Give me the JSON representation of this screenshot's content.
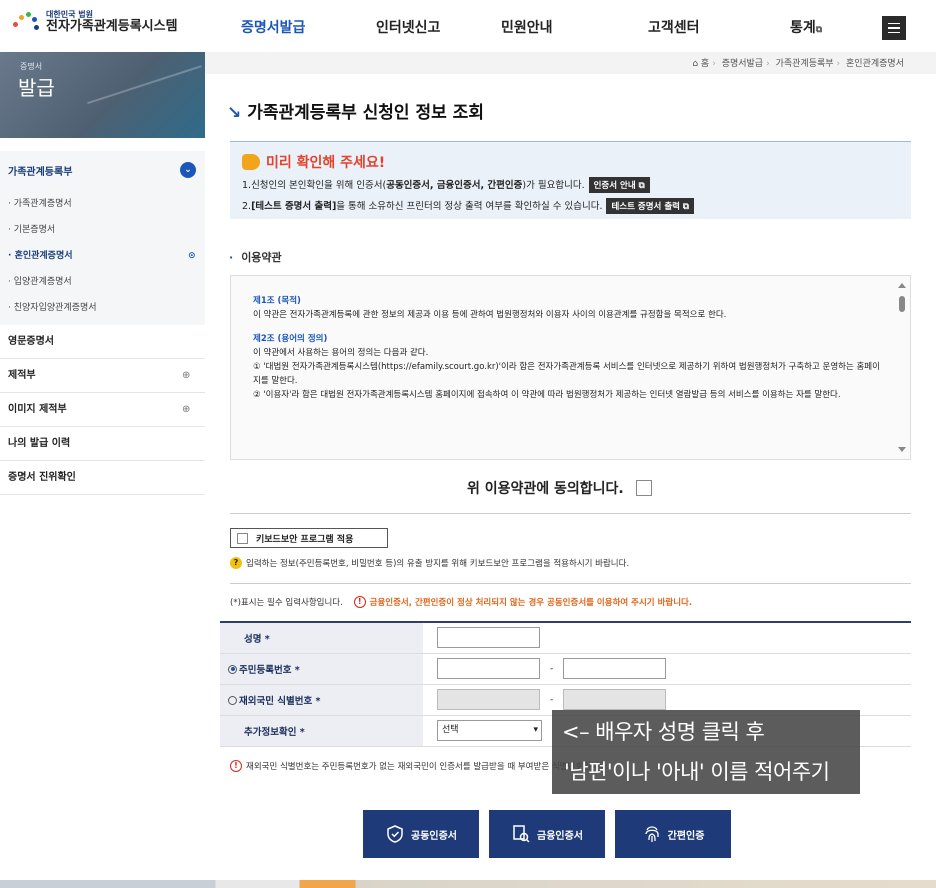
{
  "header": {
    "logo_small": "대한민국 법원",
    "logo_big": "전자가족관계등록시스템",
    "nav": [
      {
        "label": "증명서발급",
        "active": true
      },
      {
        "label": "인터넷신고"
      },
      {
        "label": "민원안내"
      },
      {
        "label": "고객센터"
      },
      {
        "label": "통계"
      }
    ]
  },
  "sidebar": {
    "banner_small": "증명서",
    "banner_big": "발급",
    "group_label": "가족관계등록부",
    "sub_items": [
      {
        "label": "가족관계증명서"
      },
      {
        "label": "기본증명서"
      },
      {
        "label": "혼인관계증명서",
        "active": true
      },
      {
        "label": "입양관계증명서"
      },
      {
        "label": "친양자입양관계증명서"
      }
    ],
    "items": [
      {
        "label": "영문증명서"
      },
      {
        "label": "제적부"
      },
      {
        "label": "이미지 제적부"
      },
      {
        "label": "나의 발급 이력"
      },
      {
        "label": "증명서 진위확인"
      }
    ]
  },
  "breadcrumb": [
    "홈",
    "증명서발급",
    "가족관계등록부",
    "혼인관계증명서"
  ],
  "page_title": "가족관계등록부 신청인 정보 조회",
  "notice": {
    "heading": "미리 확인해 주세요!",
    "line1_pre": "1.신청인의 본인확인을 위해 인증서(",
    "line1_bold": "공동인증서, 금융인증서, 간편인증",
    "line1_post": ")가 필요합니다.",
    "line1_btn": "인증서 안내",
    "line2_pre": "2.",
    "line2_bold": "[테스트 증명서 출력]",
    "line2_post": "을 통해 소유하신 프린터의 정상 출력 여부를 확인하실 수 있습니다.",
    "line2_btn": "테스트 증명서 출력"
  },
  "terms": {
    "section_title": "이용약관",
    "a1_title": "제1조 (목적)",
    "a1_text": "이 약관은 전자가족관계등록에 관한 정보의 제공과 이용 등에 관하여 법원행정처와 이용자 사이의 이용관계를 규정함을 목적으로 한다.",
    "a2_title": "제2조 (용어의 정의)",
    "a2_intro": "이 약관에서 사용하는 용어의 정의는 다음과 같다.",
    "a2_1": "① '대법원 전자가족관계등록시스템(https://efamily.scourt.go.kr)'이라 함은 전자가족관계등록 서비스를 인터넷으로 제공하기 위하여 법원행정처가 구축하고 운영하는 홈페이지를 말한다.",
    "a2_2": "② '이용자'라 함은 대법원 전자가족관계등록시스템 홈페이지에 접속하여 이 약관에 따라 법원행정처가 제공하는 인터넷 열람발급 등의 서비스를 이용하는 자를 말한다.",
    "agree_label": "위 이용약관에 동의합니다."
  },
  "keyboard": {
    "label": "키보드보안 프로그램 적용",
    "note": "입력하는 정보(주민등록번호, 비밀번호 등)의 유출 방지를 위해 키보드보안 프로그램을 적용하시기 바랍니다."
  },
  "required_note": "(*)표시는 필수 입력사항입니다.",
  "warning": "금융인증서, 간편인증이 정상 처리되지 않는 경우 공동인증서를 이용하여 주시기 바랍니다.",
  "form": {
    "name_label": "성명",
    "rrn_label": "주민등록번호",
    "foreign_label": "재외국민 식별번호",
    "extra_label": "추가정보확인",
    "select_value": "선택",
    "dash": "-",
    "star": "*"
  },
  "foreign_note": "재외국민 식별번호는 주민등록번호가 없는 재외국민이 인증서를 발급받을 때 부여받은 식별번호입니다.",
  "overlay": {
    "line1": "<– 배우자 성명 클릭 후",
    "line2": "'남편'이나 '아내' 이름 적어주기"
  },
  "buttons": [
    {
      "label": "공동인증서"
    },
    {
      "label": "금융인증서"
    },
    {
      "label": "간편인증"
    }
  ],
  "colors": {
    "accent": "#1c56b8",
    "button": "#1e3a78",
    "warning": "#e0661c"
  }
}
